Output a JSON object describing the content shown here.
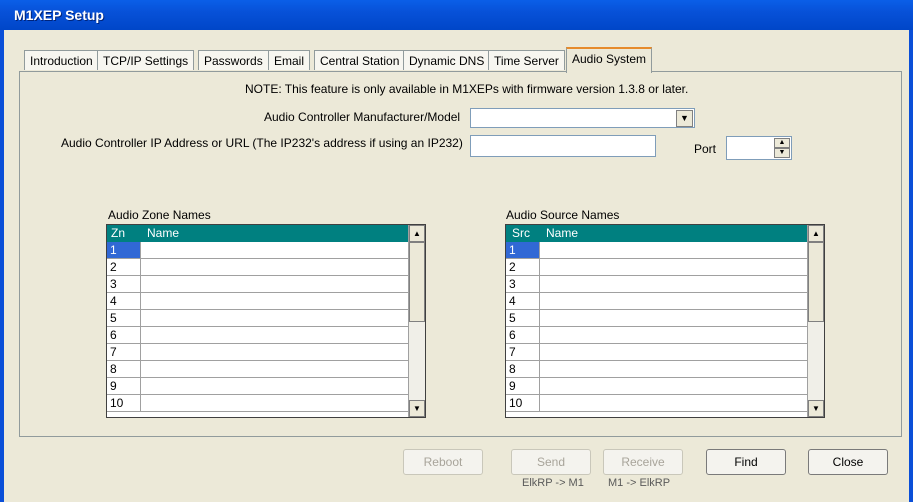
{
  "window": {
    "title": "M1XEP Setup"
  },
  "tabs": [
    {
      "label": "Introduction"
    },
    {
      "label": "TCP/IP Settings"
    },
    {
      "label": "Passwords"
    },
    {
      "label": "Email"
    },
    {
      "label": "Central Station"
    },
    {
      "label": "Dynamic DNS"
    },
    {
      "label": "Time Server"
    },
    {
      "label": "Audio System",
      "active": true
    }
  ],
  "audio": {
    "note": "NOTE: This feature is only available in M1XEPs with firmware version 1.3.8 or later.",
    "manufacturer_label": "Audio Controller Manufacturer/Model",
    "manufacturer_value": "",
    "ip_label": "Audio Controller IP Address or URL (The IP232's address if using an IP232)",
    "ip_value": "",
    "port_label": "Port",
    "port_value": "",
    "zone_names": {
      "title": "Audio Zone Names",
      "col_num": "Zn",
      "col_name": "Name",
      "rows": [
        "1",
        "2",
        "3",
        "4",
        "5",
        "6",
        "7",
        "8",
        "9",
        "10"
      ]
    },
    "source_names": {
      "title": "Audio Source Names",
      "col_num": "Src",
      "col_name": "Name",
      "rows": [
        "1",
        "2",
        "3",
        "4",
        "5",
        "6",
        "7",
        "8",
        "9",
        "10"
      ]
    }
  },
  "buttons": {
    "reboot": "Reboot",
    "send": "Send",
    "send_sub": "ElkRP -> M1",
    "receive": "Receive",
    "receive_sub": "M1 -> ElkRP",
    "find": "Find",
    "close": "Close"
  }
}
